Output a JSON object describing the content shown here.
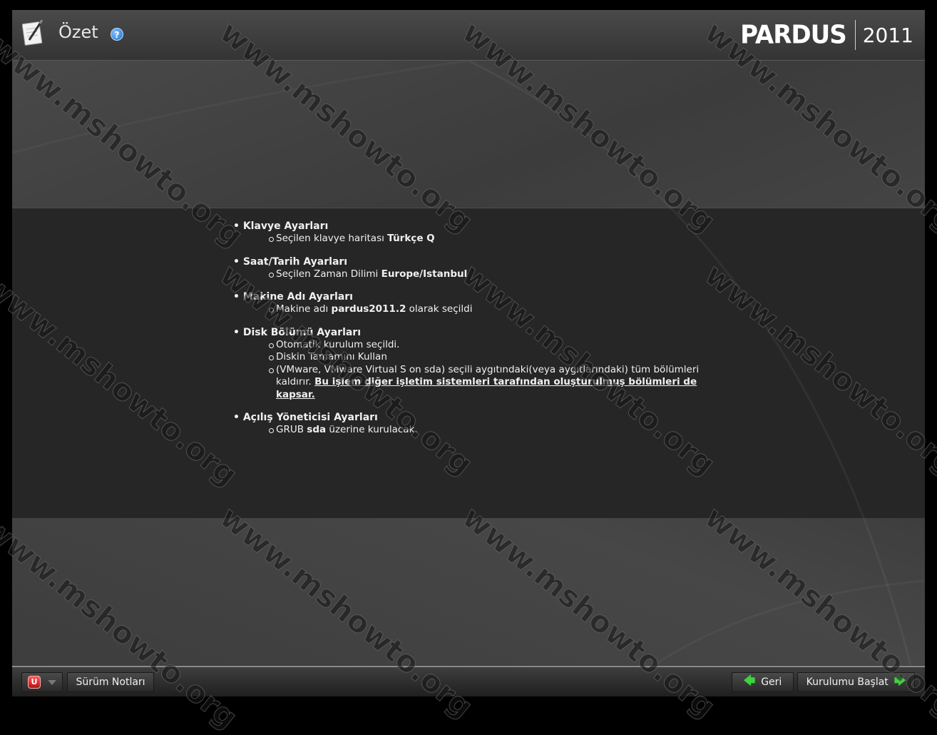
{
  "header": {
    "title": "Özet",
    "help_glyph": "?",
    "brand_name": "PARDUS",
    "brand_year": "2011"
  },
  "summary": {
    "keyboard": {
      "heading": "Klavye Ayarları",
      "item1_prefix": "Seçilen klavye haritası ",
      "item1_value": "Türkçe Q"
    },
    "datetime": {
      "heading": "Saat/Tarih Ayarları",
      "item1_prefix": "Seçilen Zaman Dilimi ",
      "item1_value": "Europe/Istanbul"
    },
    "hostname": {
      "heading": "Makine Adı Ayarları",
      "item1_prefix": "Makine adı ",
      "item1_value": "pardus2011.2",
      "item1_suffix": " olarak seçildi"
    },
    "disk": {
      "heading": "Disk Bölümü Ayarları",
      "item1": "Otomatik kurulum seçildi.",
      "item2": "Diskin Tamamını Kullan",
      "item3_text": "(VMware, VMware Virtual S on sda) seçili aygıtındaki(veya aygıtlarındaki) tüm bölümleri kaldırır. ",
      "item3_warning": "Bu işlem diğer işletim sistemleri tarafından oluşturulmuş bölümleri de kapsar."
    },
    "bootloader": {
      "heading": "Açılış Yöneticisi Ayarları",
      "item1_prefix": "GRUB ",
      "item1_value": "sda",
      "item1_suffix": " üzerine kurulacak."
    }
  },
  "footer": {
    "power_glyph": "U",
    "release_notes_label": "Sürüm Notları",
    "back_label": "Geri",
    "start_install_label": "Kurulumu Başlat",
    "back_arrow": "🡄",
    "forward_arrow": "🡆"
  },
  "watermark": {
    "text": "www.mshowto.org"
  },
  "colors": {
    "background": "#3a3a3a",
    "content_band": "#262626",
    "text": "#f0f0f0",
    "arrow_green": "#3fd33f",
    "power_red": "#d42020",
    "help_blue": "#1f6fcf"
  }
}
